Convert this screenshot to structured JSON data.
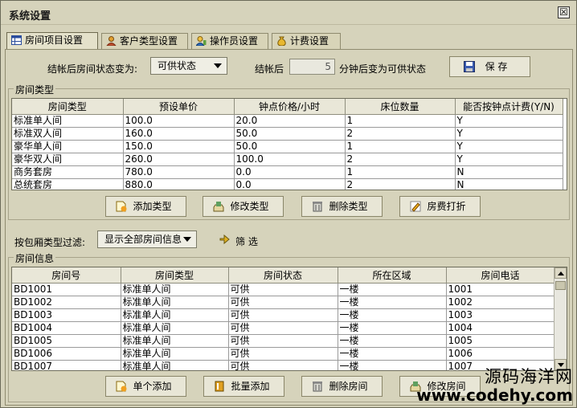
{
  "window": {
    "title": "系统设置",
    "close_glyph": "☒"
  },
  "tabs": [
    {
      "label": "房间项目设置",
      "icon": "grid-icon",
      "active": true
    },
    {
      "label": "客户类型设置",
      "icon": "user-icon",
      "active": false
    },
    {
      "label": "操作员设置",
      "icon": "operator-icon",
      "active": false
    },
    {
      "label": "计费设置",
      "icon": "money-bag-icon",
      "active": false
    }
  ],
  "checkout": {
    "status_label": "结帐后房间状态变为:",
    "status_value": "可供状态",
    "after_label": "结帐后",
    "minutes_value": "5",
    "minutes_suffix": "分钟后变为可供状态",
    "save_label": "保 存"
  },
  "room_types": {
    "group_title": "房间类型",
    "columns": [
      "房间类型",
      "预设单价",
      "钟点价格/小时",
      "床位数量",
      "能否按钟点计费(Y/N)"
    ],
    "rows": [
      [
        "标准单人间",
        "100.0",
        "20.0",
        "1",
        "Y"
      ],
      [
        "标准双人间",
        "160.0",
        "50.0",
        "2",
        "Y"
      ],
      [
        "豪华单人间",
        "150.0",
        "50.0",
        "1",
        "Y"
      ],
      [
        "豪华双人间",
        "260.0",
        "100.0",
        "2",
        "Y"
      ],
      [
        "商务套房",
        "780.0",
        "0.0",
        "1",
        "N"
      ],
      [
        "总统套房",
        "880.0",
        "0.0",
        "2",
        "N"
      ]
    ],
    "buttons": {
      "add": "添加类型",
      "edit": "修改类型",
      "delete": "删除类型",
      "discount": "房费打折"
    }
  },
  "filter": {
    "label": "按包厢类型过滤:",
    "value": "显示全部房间信息",
    "button_label": "筛 选"
  },
  "rooms": {
    "group_title": "房间信息",
    "columns": [
      "房间号",
      "房间类型",
      "房间状态",
      "所在区域",
      "房间电话"
    ],
    "rows": [
      [
        "BD1001",
        "标准单人间",
        "可供",
        "一楼",
        "1001"
      ],
      [
        "BD1002",
        "标准单人间",
        "可供",
        "一楼",
        "1002"
      ],
      [
        "BD1003",
        "标准单人间",
        "可供",
        "一楼",
        "1003"
      ],
      [
        "BD1004",
        "标准单人间",
        "可供",
        "一楼",
        "1004"
      ],
      [
        "BD1005",
        "标准单人间",
        "可供",
        "一楼",
        "1005"
      ],
      [
        "BD1006",
        "标准单人间",
        "可供",
        "一楼",
        "1006"
      ],
      [
        "BD1007",
        "标准单人间",
        "可供",
        "一楼",
        "1007"
      ]
    ],
    "buttons": {
      "add_one": "单个添加",
      "batch_add": "批量添加",
      "delete": "删除房间",
      "edit": "修改房间"
    }
  },
  "watermark": {
    "line1": "源码海洋网",
    "line2": "www.codehy.com"
  }
}
